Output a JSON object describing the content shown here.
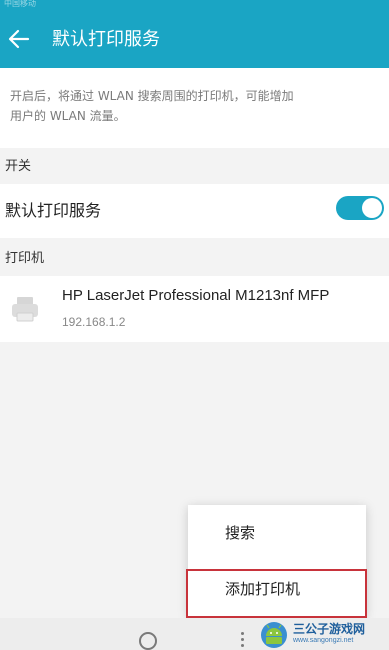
{
  "status_bar": {
    "carrier": "中国移动"
  },
  "app_bar": {
    "title": "默认打印服务",
    "back_icon": "arrow-left-icon"
  },
  "description": {
    "line1": "开启后，将通过 WLAN 搜索周围的打印机，可能增加",
    "line2": "用户的 WLAN 流量。"
  },
  "switch_section": {
    "header": "开关",
    "label": "默认打印服务",
    "enabled": true
  },
  "printer_section": {
    "header": "打印机",
    "printers": [
      {
        "name": "HP LaserJet Professional M1213nf MFP",
        "ip": "192.168.1.2",
        "icon": "printer-icon"
      }
    ]
  },
  "overflow_menu": {
    "items": [
      {
        "label": "搜索"
      },
      {
        "label": "添加打印机",
        "highlighted": true
      }
    ]
  },
  "watermark": {
    "name": "三公子游戏网",
    "url": "www.sangongzi.net"
  },
  "colors": {
    "accent": "#1aa5c4",
    "highlight": "#c8333b"
  }
}
